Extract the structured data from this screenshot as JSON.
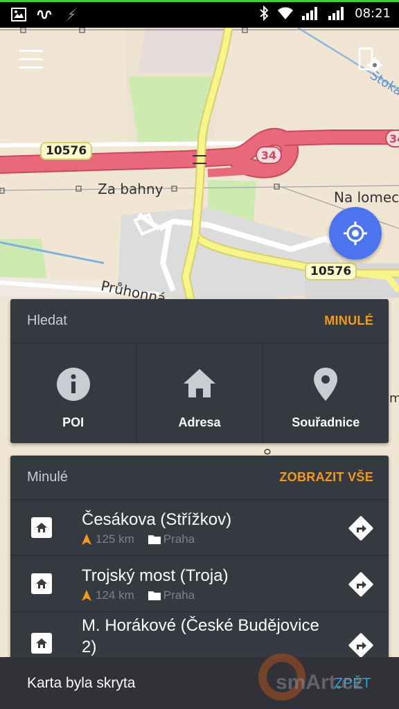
{
  "status_bar": {
    "time": "08:21",
    "left_icons": [
      "image-icon",
      "signal-wave-icon",
      "flash-icon"
    ],
    "right_icons": [
      "bluetooth-icon",
      "wifi-icon",
      "cell-signal-icon",
      "cell-signal-icon"
    ]
  },
  "map": {
    "labels": {
      "road_1": "10576",
      "road_2": "10576",
      "highway": "34",
      "highway_edge": "34",
      "street_za_bahny": "Za bahny",
      "street_na_lomech": "Na lomech",
      "street_pruh": "Průhonná",
      "street_stoka": "Stoka",
      "edge_right": "me",
      "edge_mid": "on"
    },
    "colors": {
      "land": "#f1e6d3",
      "green": "#cdeab0",
      "highway": "#e8697a",
      "primary_road": "#f7f48a",
      "residential": "#dcdcdc"
    }
  },
  "controls": {
    "menu_icon": "hamburger-menu-icon",
    "settings_icon": "device-settings-icon",
    "locate_icon": "gps-target-icon",
    "accent": "#4b74ee"
  },
  "search": {
    "title": "Hledat",
    "action": "MINULÉ",
    "options": [
      {
        "label": "POI",
        "icon": "info-icon"
      },
      {
        "label": "Adresa",
        "icon": "house-icon"
      },
      {
        "label": "Souřadnice",
        "icon": "location-pin-icon"
      }
    ]
  },
  "recent": {
    "title": "Minulé",
    "action": "ZOBRAZIT VŠE",
    "items": [
      {
        "name": "Česákova (Střížkov)",
        "distance": "125 km",
        "folder": "Praha"
      },
      {
        "name": "Trojský most (Troja)",
        "distance": "124 km",
        "folder": "Praha"
      },
      {
        "name": "M. Horákové (České Budějovice 2)",
        "distance": "",
        "folder": ""
      }
    ]
  },
  "snackbar": {
    "message": "Karta byla skryta",
    "action": "ZPĚT"
  },
  "watermark": "smArt.cz",
  "accent_orange": "#f19a1b",
  "accent_blue": "#2aa4e0"
}
